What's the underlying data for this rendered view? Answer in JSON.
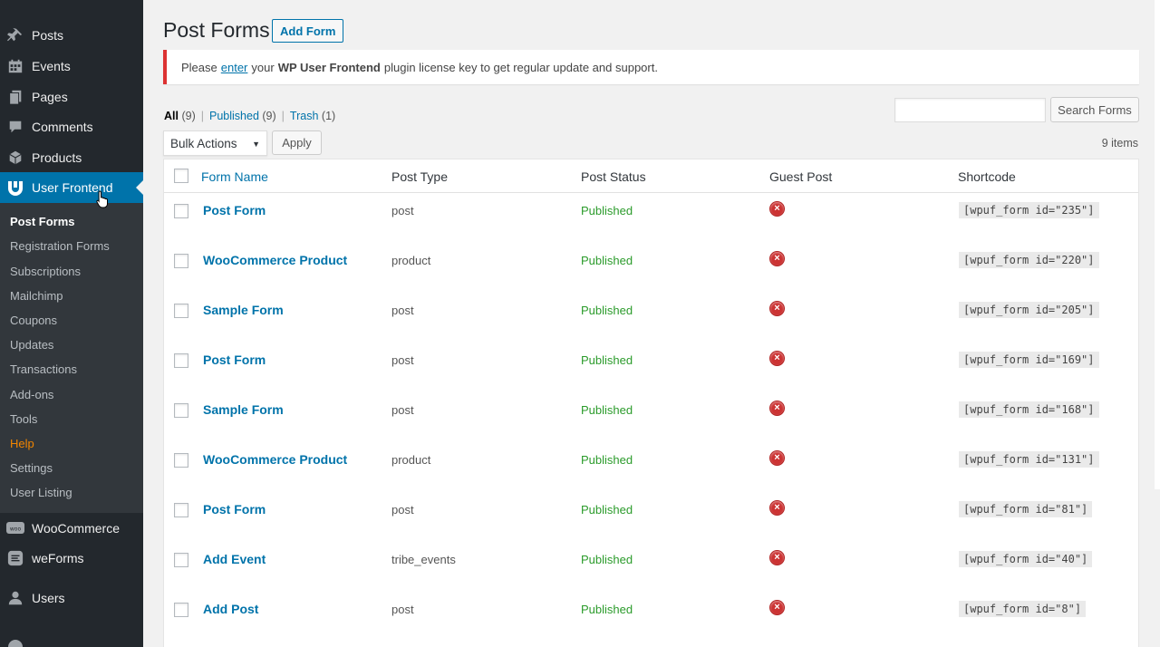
{
  "sidebar": {
    "items": [
      {
        "label": "Posts",
        "icon": "pin-icon"
      },
      {
        "label": "Events",
        "icon": "calendar-icon"
      },
      {
        "label": "Pages",
        "icon": "pages-icon"
      },
      {
        "label": "Comments",
        "icon": "comment-icon"
      },
      {
        "label": "Products",
        "icon": "products-icon"
      },
      {
        "label": "User Frontend",
        "icon": "wpuf-logo-icon"
      },
      {
        "label": "WooCommerce",
        "icon": "woo-icon"
      },
      {
        "label": "weForms",
        "icon": "weforms-icon"
      },
      {
        "label": "Users",
        "icon": "user-icon"
      }
    ],
    "submenu": [
      "Post Forms",
      "Registration Forms",
      "Subscriptions",
      "Mailchimp",
      "Coupons",
      "Updates",
      "Transactions",
      "Add-ons",
      "Tools",
      "Help",
      "Settings",
      "User Listing"
    ]
  },
  "page": {
    "title": "Post Forms",
    "add_button": "Add Form"
  },
  "notice": {
    "before": "Please",
    "link": "enter",
    "middle": "your",
    "bold": "WP User Frontend",
    "after": "plugin license key to get regular update and support."
  },
  "filters": {
    "all_label": "All",
    "all_count": "(9)",
    "published_label": "Published",
    "published_count": "(9)",
    "trash_label": "Trash",
    "trash_count": "(1)",
    "separator": "|"
  },
  "search": {
    "placeholder": "",
    "button": "Search Forms"
  },
  "bulk": {
    "selected": "Bulk Actions",
    "apply": "Apply"
  },
  "items_count": "9 items",
  "table": {
    "headers": {
      "name": "Form Name",
      "type": "Post Type",
      "status": "Post Status",
      "guest": "Guest Post",
      "shortcode": "Shortcode"
    },
    "rows": [
      {
        "name": "Post Form",
        "type": "post",
        "status": "Published",
        "shortcode": "[wpuf_form id=\"235\"]"
      },
      {
        "name": "WooCommerce Product",
        "type": "product",
        "status": "Published",
        "shortcode": "[wpuf_form id=\"220\"]"
      },
      {
        "name": "Sample Form",
        "type": "post",
        "status": "Published",
        "shortcode": "[wpuf_form id=\"205\"]"
      },
      {
        "name": "Post Form",
        "type": "post",
        "status": "Published",
        "shortcode": "[wpuf_form id=\"169\"]"
      },
      {
        "name": "Sample Form",
        "type": "post",
        "status": "Published",
        "shortcode": "[wpuf_form id=\"168\"]"
      },
      {
        "name": "WooCommerce Product",
        "type": "product",
        "status": "Published",
        "shortcode": "[wpuf_form id=\"131\"]"
      },
      {
        "name": "Post Form",
        "type": "post",
        "status": "Published",
        "shortcode": "[wpuf_form id=\"81\"]"
      },
      {
        "name": "Add Event",
        "type": "tribe_events",
        "status": "Published",
        "shortcode": "[wpuf_form id=\"40\"]"
      },
      {
        "name": "Add Post",
        "type": "post",
        "status": "Published",
        "shortcode": "[wpuf_form id=\"8\"]"
      }
    ]
  },
  "colors": {
    "sidebar_bg": "#23282d",
    "accent": "#0073aa",
    "published": "#2b9b2b",
    "help": "#f18500",
    "notice_border": "#dc3232"
  }
}
